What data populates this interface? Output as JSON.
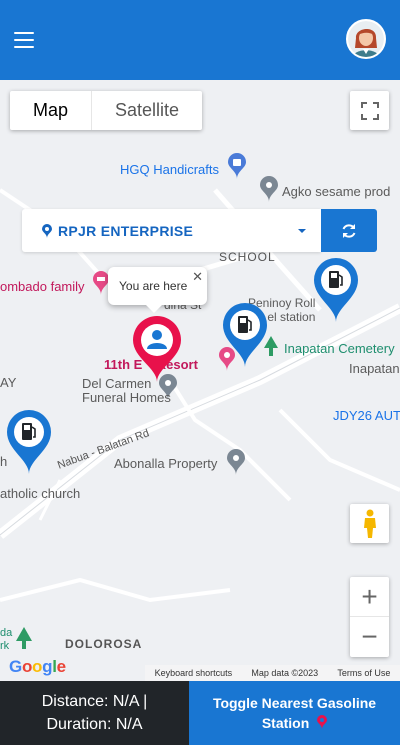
{
  "header": {
    "menu_icon": "hamburger-icon",
    "avatar": "user-avatar"
  },
  "map": {
    "type_buttons": [
      "Map",
      "Satellite"
    ],
    "selected_type": "Map",
    "labels": {
      "hgq": "HGQ Handicrafts",
      "agko": "Agko sesame prod",
      "school": "SCHOOL",
      "ombado": "ombado family",
      "ina_st": "dina St",
      "peninoy": "Peninoy Roll",
      "peninoy2": "b     el station",
      "inapatan_cem": "Inapatan Cemetery",
      "inapatan": "Inapatan",
      "resort": "11th E    Resort",
      "ay": "AY",
      "delcarmen1": "Del Carmen",
      "delcarmen2": "Funeral Homes",
      "jdy": "JDY26 AUT",
      "road": "Nabua - Balatan Rd",
      "abonalla": "Abonalla Property",
      "church": "atholic church",
      "h": "h",
      "dolorosa": "DOLOROSA",
      "da": "da",
      "rk": "rk"
    },
    "infowindow": "You are here",
    "google": "Google",
    "attribution": [
      "Keyboard shortcuts",
      "Map data ©2023",
      "Terms of Use"
    ]
  },
  "station_select": {
    "value": "RPJR ENTERPRISE"
  },
  "bottom": {
    "distance": "Distance: N/A |",
    "duration": "Duration: N/A",
    "toggle_line1": "Toggle Nearest Gasoline",
    "toggle_line2": "Station"
  },
  "colors": {
    "primary": "#1976d2",
    "dark": "#212529",
    "user_pin": "#e8114b",
    "map_bg": "#eef0f3"
  }
}
